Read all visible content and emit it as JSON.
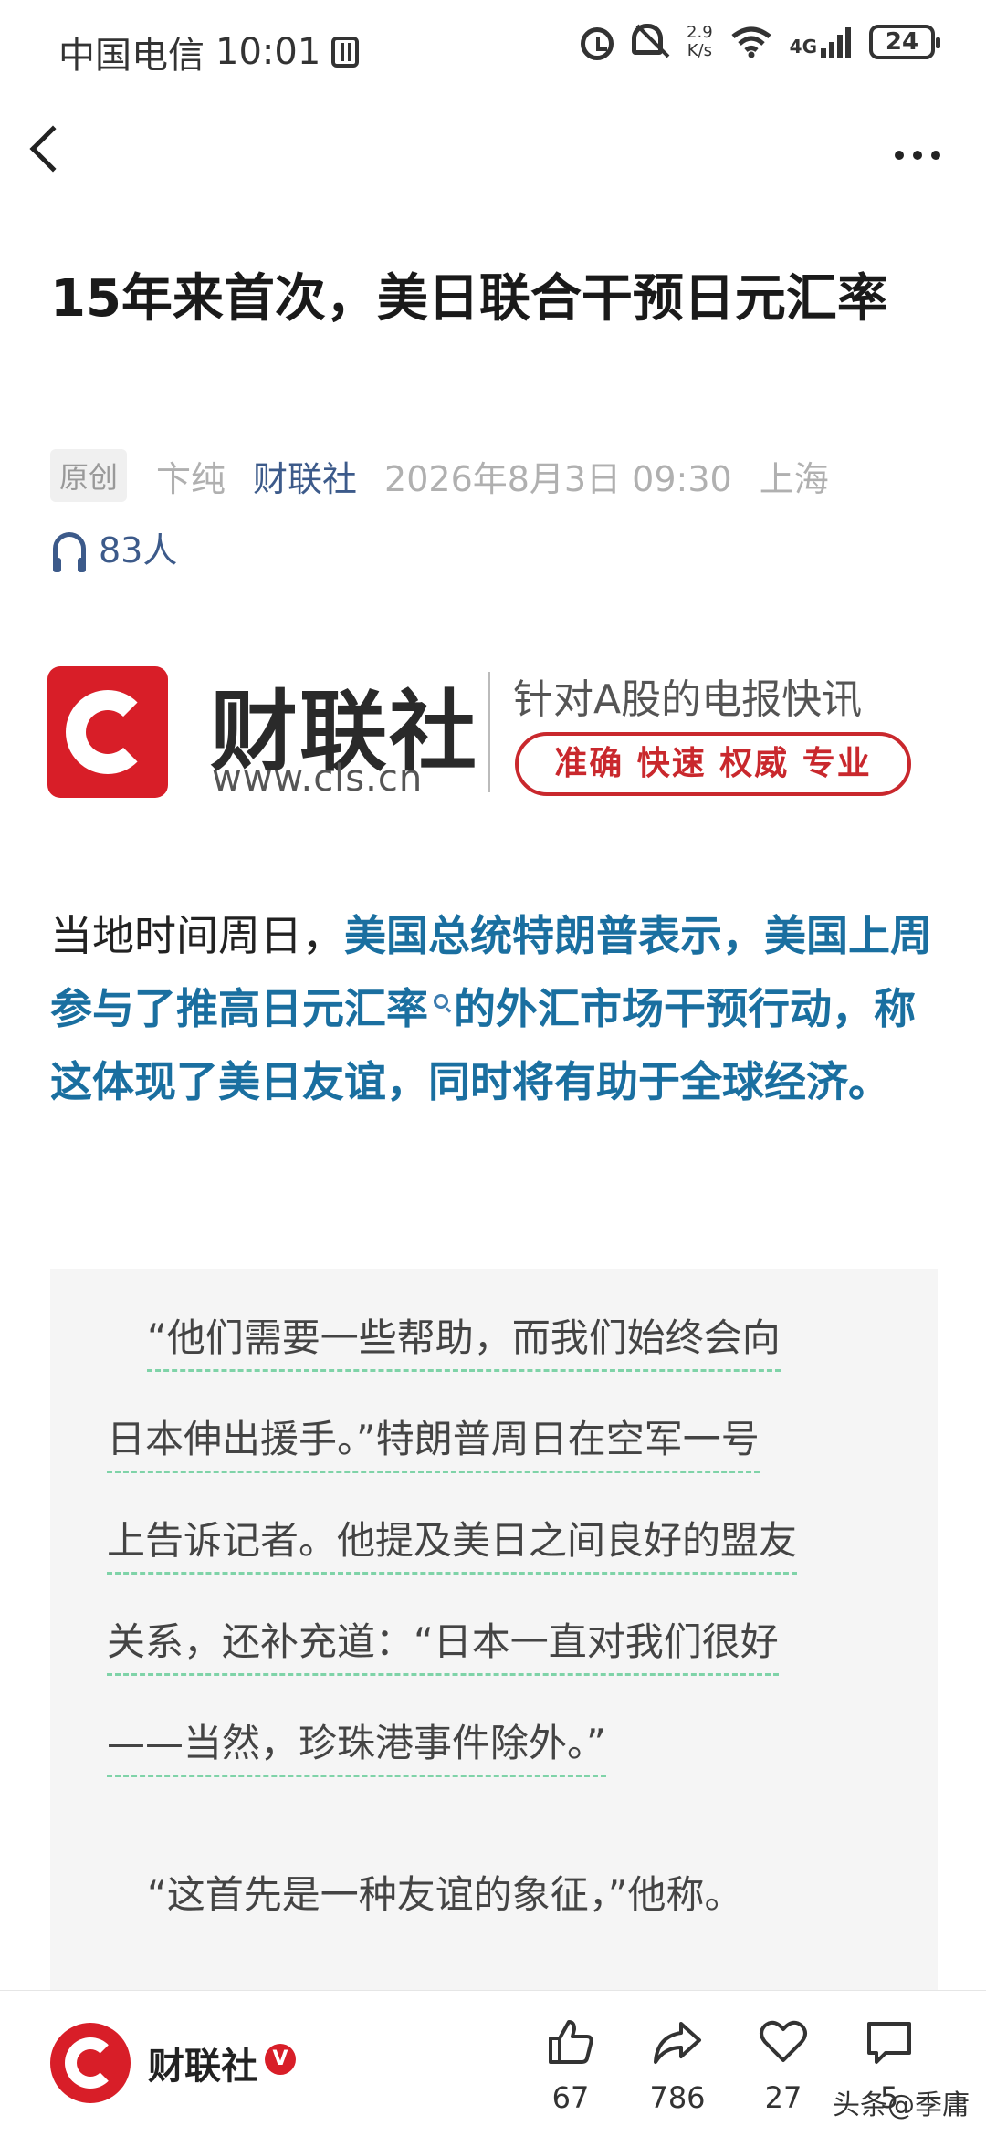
{
  "status_bar": {
    "carrier": "中国电信",
    "time": "10:01",
    "speed_value": "2.9",
    "speed_unit": "K/s",
    "network": "4G",
    "battery": "24"
  },
  "nav": {
    "back_icon": "back-icon",
    "more_icon": "more-icon"
  },
  "article": {
    "title": "15年来首次，美日联合干预日元汇率",
    "original_tag": "原创",
    "author": "卞纯",
    "source": "财联社",
    "date": "2026年8月3日 09:30",
    "location": "上海",
    "listeners": "83人"
  },
  "banner": {
    "brand": "财联社",
    "url": "www.cls.cn",
    "slogan": "针对A股的电报快讯",
    "tags": "准确 快速 权威 专业"
  },
  "lead": {
    "plain_prefix": "当地时间周日，",
    "hl_part1": "美国总统特朗普表示，美国上周参与了推高日元汇率",
    "hl_part2": "的外汇市场干预行动，称这体现了美日友谊，同时将有助于全球经济。"
  },
  "quote": {
    "lines": [
      "“他们需要一些帮助，而我们始终会向",
      "日本伸出援手。”特朗普周日在空军一号",
      "上告诉记者。他提及美日之间良好的盟友",
      "关系，还补充道：“日本一直对我们很好",
      "——当然，珍珠港事件除外。”"
    ],
    "next_paragraph": "“这首先是一种友谊的象征，”他称。"
  },
  "bottom_bar": {
    "publisher": "财联社",
    "verified_mark": "V",
    "likes": "67",
    "shares": "786",
    "favorites": "27",
    "comments": "5",
    "watermark": "头条@季庸"
  },
  "colors": {
    "brand_red": "#d81e28",
    "link_blue": "#1a6fa0",
    "source_blue": "#3c5a8a",
    "dash_green": "#7fd3a8"
  }
}
